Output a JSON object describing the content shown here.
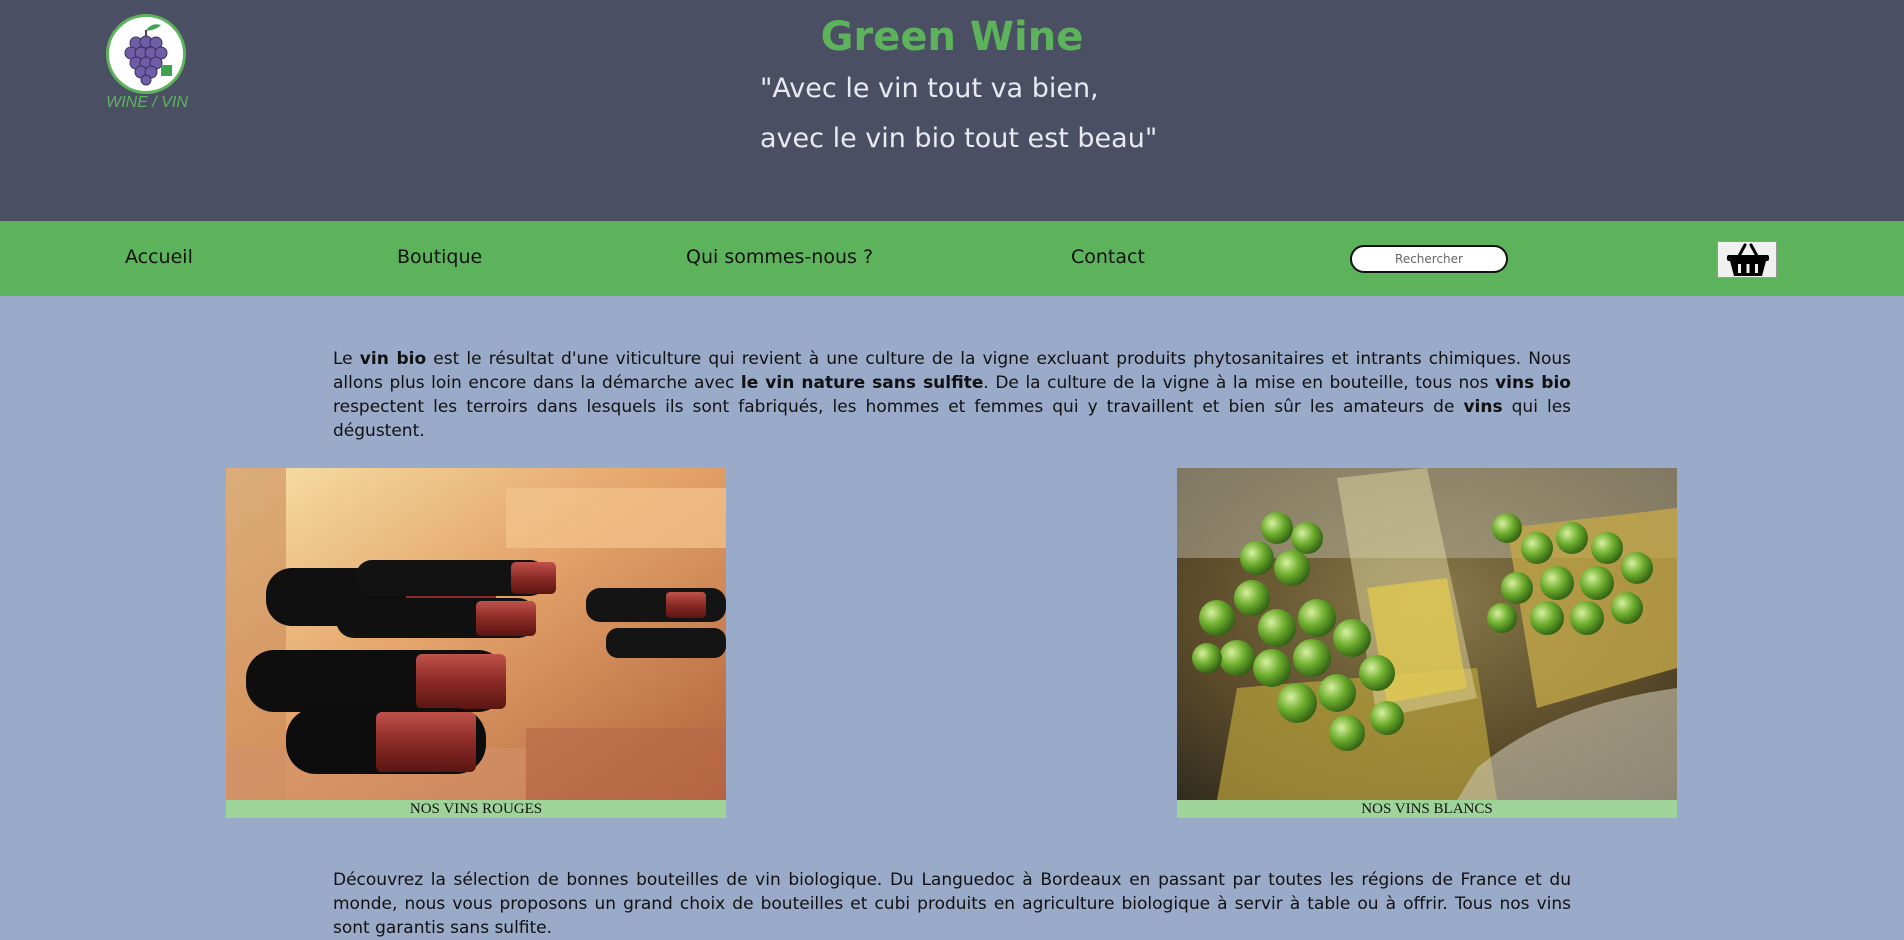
{
  "header": {
    "logo_caption": "WINE / VIN",
    "title": "Green Wine",
    "tagline_line1": "\"Avec le vin tout va bien,",
    "tagline_line2": "avec le vin bio tout est beau\""
  },
  "nav": {
    "items": [
      {
        "label": "Accueil"
      },
      {
        "label": "Boutique"
      },
      {
        "label": "Qui sommes-nous ?"
      },
      {
        "label": "Contact"
      }
    ],
    "search_placeholder": "Rechercher",
    "cart_icon": "basket-icon"
  },
  "intro": {
    "t1": "Le ",
    "b1": "vin bio",
    "t2": " est le résultat d'une viticulture qui revient à une culture de la vigne excluant produits phytosanitaires et intrants chimiques. Nous allons plus loin encore dans la démarche avec ",
    "b2": "le vin nature sans sulfite",
    "t3": ". De la culture de la vigne à la mise en bouteille, tous nos ",
    "b3": "vins bio",
    "t4": " respectent les terroirs dans lesquels ils sont fabriqués, les hommes et femmes qui y travaillent et bien sûr les amateurs de ",
    "b4": "vins",
    "t5": " qui les dégustent."
  },
  "cards": {
    "red_caption": "NOS VINS ROUGES",
    "white_caption": "NOS VINS BLANCS"
  },
  "outro": {
    "text": "Découvrez la sélection de bonnes bouteilles de vin biologique. Du Languedoc à Bordeaux en passant par toutes les régions de France et du monde, nous vous proposons un grand choix de bouteilles et cubi produits en agriculture biologique à servir à table ou à offrir. Tous nos vins sont garantis sans sulfite."
  },
  "colors": {
    "header_bg": "#4b4f64",
    "nav_bg": "#5db35b",
    "page_bg": "#9aaac9",
    "accent_green": "#5db35b",
    "caption_bg": "#9ed39a"
  }
}
